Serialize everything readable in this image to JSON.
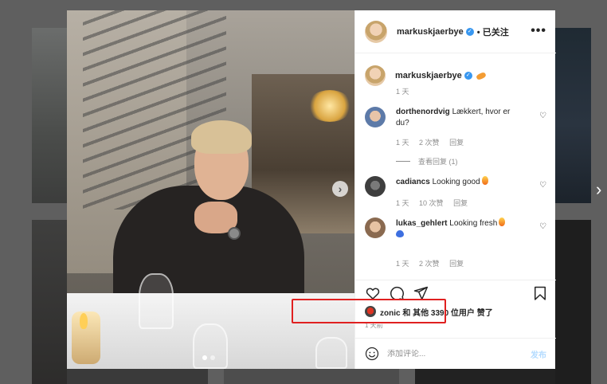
{
  "post": {
    "username": "markuskjaerbye",
    "follow_label": "• 已关注",
    "more_label": "•••"
  },
  "caption": {
    "username": "markuskjaerbye",
    "time": "1 天"
  },
  "comments": [
    {
      "user": "dorthenordvig",
      "text": "Lækkert, hvor er du?",
      "time": "1 天",
      "likes": "2 次赞",
      "reply": "回复",
      "view_replies": "查看回复 (1)"
    },
    {
      "user": "cadiancs",
      "text": "Looking good",
      "time": "1 天",
      "likes": "10 次赞",
      "reply": "回复"
    },
    {
      "user": "lukas_gehlert",
      "text": "Looking fresh",
      "time": "1 天",
      "likes": "2 次赞",
      "reply": "回复"
    }
  ],
  "likes_text": "zonic 和 其他 3390 位用户 赞了",
  "time_ago": "1 天前",
  "add_comment": {
    "placeholder": "添加评论...",
    "post_label": "发布"
  },
  "icons": {
    "like": "heart-icon",
    "comment": "comment-icon",
    "share": "share-icon",
    "save": "bookmark-icon",
    "emoji": "smile-icon"
  },
  "colors": {
    "verified": "#3897f0",
    "highlight": "#e02020",
    "post_button": "#b3dbff"
  }
}
